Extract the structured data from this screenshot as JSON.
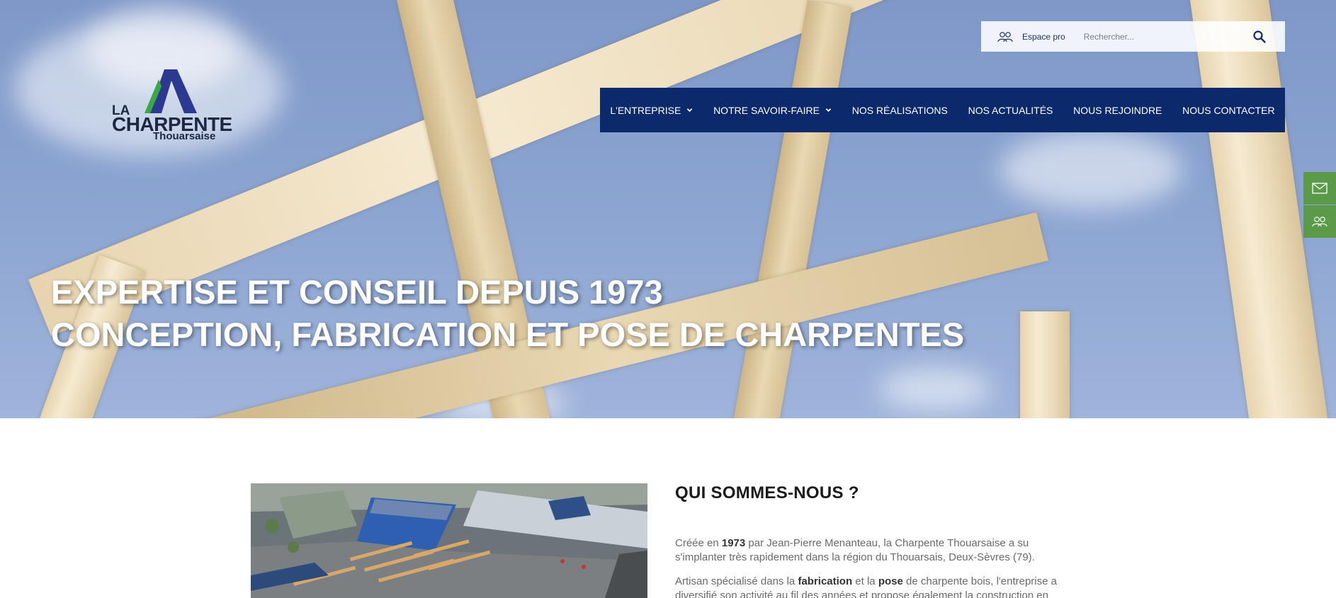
{
  "brand": {
    "line1": "LA",
    "line2": "CHARPENTE",
    "line3": "Thouarsaise",
    "colors": {
      "navy": "#2b3990",
      "green": "#3aa845"
    }
  },
  "topbar": {
    "espace_label": "Espace pro",
    "espace_icon": "users-icon",
    "search_placeholder": "Rechercher...",
    "search_icon": "search-icon"
  },
  "nav": {
    "background": "#0c2a6b",
    "items": [
      {
        "label": "L'ENTREPRISE",
        "dropdown": true
      },
      {
        "label": "NOTRE SAVOIR-FAIRE",
        "dropdown": true
      },
      {
        "label": "NOS RÉALISATIONS",
        "dropdown": false
      },
      {
        "label": "NOS ACTUALITÉS",
        "dropdown": false
      },
      {
        "label": "NOUS REJOINDRE",
        "dropdown": false
      },
      {
        "label": "NOUS CONTACTER",
        "dropdown": false
      }
    ]
  },
  "hero": {
    "line1": "EXPERTISE ET CONSEIL DEPUIS 1973",
    "line2": "CONCEPTION, FABRICATION ET POSE DE CHARPENTES"
  },
  "side_buttons": [
    {
      "icon": "mail-icon"
    },
    {
      "icon": "users-icon"
    }
  ],
  "about": {
    "title": "QUI SOMMES-NOUS ?",
    "p1": {
      "a": "Créée en ",
      "b": "1973",
      "c": " par Jean-Pierre Menanteau, la Charpente Thouarsaise a su s'implanter très rapidement dans la région du Thouarsais, Deux-Sèvres (79)."
    },
    "p2": {
      "a": "Artisan spécialisé dans la ",
      "b": "fabrication",
      "c": " et la ",
      "d": "pose",
      "e": " de charpente bois, l'entreprise a diversifié son activité au fil des années et propose également la construction en"
    }
  },
  "accent_green": "#5a9a48"
}
